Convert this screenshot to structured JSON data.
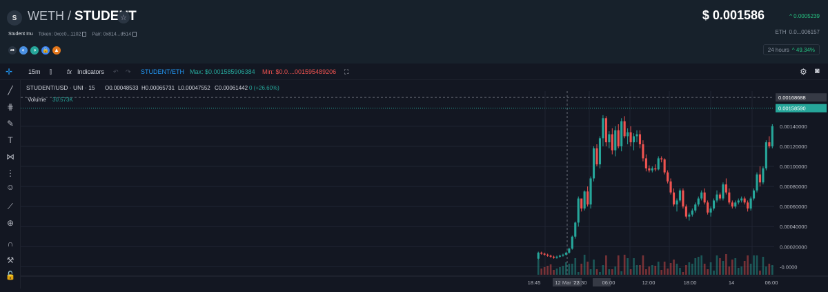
{
  "header": {
    "logo_letter": "S",
    "base": "WETH",
    "slash": " / ",
    "quote": "STUDENT",
    "token_name": "Student Inu",
    "token_label": "Token: 0xcc0...1102",
    "pair_label": "Pair: 0x814...d514",
    "price": "$ 0.001586",
    "price_delta": "^ 0.0005239",
    "eth_label": "ETH",
    "eth_value": "0.0...006157",
    "period": "24 hours",
    "period_change": "^ 49.34%"
  },
  "toolbar": {
    "interval": "15m",
    "indicators": "Indicators",
    "symbol": "STUDENT/ETH",
    "max_label": "Max: $0.001585906384",
    "min_label": "Min: $0.0....001595489206"
  },
  "legend": {
    "title": "STUDENT/USD · UNI · 15",
    "o": "O0.00048533",
    "h": "H0.00065731",
    "l": "L0.00047552",
    "c": "C0.00061442",
    "chg": "0 (+26.60%)",
    "volume_label": "Volume",
    "volume_value": "30.573K"
  },
  "colors": {
    "up": "#26a69a",
    "down": "#ef5350",
    "accent": "#2196f3",
    "bg": "#131722"
  },
  "chart_data": {
    "type": "candlestick",
    "title": "STUDENT/USD · UNI · 15",
    "y_ticks": [
      "0.00140000",
      "0.00120000",
      "0.00100000",
      "0.00080000",
      "0.00060000",
      "0.00040000",
      "0.00020000",
      "-0.0000"
    ],
    "y_tick_values": [
      0.0014,
      0.0012,
      0.001,
      0.0008,
      0.0006,
      0.0004,
      0.0002,
      0
    ],
    "ylim": [
      -8e-05,
      0.00175
    ],
    "price_label": "0.00158590",
    "crosshair_label": "0.00168688",
    "crosshair_value": 0.00168688,
    "x_ticks": [
      "18:45",
      "12 Mar '22",
      "23:30",
      "06:00",
      "12:00",
      "18:00",
      "14",
      "06:00"
    ],
    "candles": [
      [
        8e-05,
        0.00015,
        7e-05,
        0.00014
      ],
      [
        0.00014,
        0.00015,
        0.00012,
        0.00013
      ],
      [
        0.00013,
        0.00014,
        0.00011,
        0.00012
      ],
      [
        0.00012,
        0.00013,
        0.0001,
        0.00011
      ],
      [
        0.00011,
        0.00012,
        9e-05,
        0.0001
      ],
      [
        0.0001,
        0.00011,
        8e-05,
        9e-05
      ],
      [
        9e-05,
        0.00011,
        8e-05,
        0.0001
      ],
      [
        0.0001,
        0.00012,
        9e-05,
        0.00011
      ],
      [
        0.00011,
        0.00013,
        0.0001,
        0.00012
      ],
      [
        0.00012,
        0.00015,
        0.00011,
        0.00014
      ],
      [
        0.00014,
        0.00019,
        0.00013,
        0.00018
      ],
      [
        0.00018,
        0.00031,
        0.00017,
        0.0003
      ],
      [
        0.0003,
        0.00045,
        0.00028,
        0.00044
      ],
      [
        0.00044,
        0.0007,
        0.0004,
        0.00068
      ],
      [
        0.00068,
        0.00062,
        0.00055,
        0.00058
      ],
      [
        0.00058,
        0.00076,
        0.00056,
        0.00075
      ],
      [
        0.00075,
        0.0008,
        0.0006,
        0.00062
      ],
      [
        0.00062,
        0.0009,
        0.00058,
        0.00088
      ],
      [
        0.00088,
        0.0012,
        0.00085,
        0.00118
      ],
      [
        0.00118,
        0.00122,
        0.001,
        0.00102
      ],
      [
        0.00102,
        0.0013,
        0.00098,
        0.00128
      ],
      [
        0.00128,
        0.00151,
        0.0012,
        0.00148
      ],
      [
        0.00148,
        0.0015,
        0.0012,
        0.00124
      ],
      [
        0.00124,
        0.00135,
        0.00118,
        0.00132
      ],
      [
        0.00132,
        0.00138,
        0.00112,
        0.00116
      ],
      [
        0.00116,
        0.0014,
        0.0011,
        0.00136
      ],
      [
        0.00136,
        0.00142,
        0.00118,
        0.0012
      ],
      [
        0.0012,
        0.00148,
        0.00115,
        0.00145
      ],
      [
        0.00145,
        0.0015,
        0.00128,
        0.0013
      ],
      [
        0.0013,
        0.00138,
        0.00122,
        0.00134
      ],
      [
        0.00134,
        0.0014,
        0.0012,
        0.00124
      ],
      [
        0.00124,
        0.00133,
        0.00116,
        0.0013
      ],
      [
        0.0013,
        0.00136,
        0.00124,
        0.00132
      ],
      [
        0.00132,
        0.00136,
        0.00118,
        0.00122
      ],
      [
        0.00122,
        0.00126,
        0.00105,
        0.00108
      ],
      [
        0.00108,
        0.00112,
        0.00095,
        0.00098
      ],
      [
        0.00098,
        0.00101,
        0.00094,
        0.00096
      ],
      [
        0.00096,
        0.001,
        0.00094,
        0.00098
      ],
      [
        0.00098,
        0.00102,
        0.00095,
        0.00097
      ],
      [
        0.00097,
        0.0011,
        0.00096,
        0.00108
      ],
      [
        0.00108,
        0.0011,
        0.00104,
        0.00107
      ],
      [
        0.00107,
        0.00108,
        0.00092,
        0.00094
      ],
      [
        0.00094,
        0.00096,
        0.00083,
        0.00085
      ],
      [
        0.00085,
        0.00088,
        0.00072,
        0.00074
      ],
      [
        0.00074,
        0.00078,
        0.0006,
        0.00062
      ],
      [
        0.00062,
        0.00068,
        0.00055,
        0.00066
      ],
      [
        0.00066,
        0.00078,
        0.00064,
        0.00076
      ],
      [
        0.00076,
        0.00078,
        0.00058,
        0.0006
      ],
      [
        0.0006,
        0.00062,
        0.00048,
        0.0005
      ],
      [
        0.0005,
        0.00054,
        0.00046,
        0.00052
      ],
      [
        0.00052,
        0.00058,
        0.0005,
        0.00056
      ],
      [
        0.00056,
        0.00064,
        0.00054,
        0.00062
      ],
      [
        0.00062,
        0.0007,
        0.0006,
        0.00068
      ],
      [
        0.00068,
        0.00076,
        0.00066,
        0.00074
      ],
      [
        0.00074,
        0.00078,
        0.00062,
        0.00064
      ],
      [
        0.00064,
        0.00066,
        0.00052,
        0.00054
      ],
      [
        0.00054,
        0.0006,
        0.0005,
        0.00058
      ],
      [
        0.00058,
        0.00068,
        0.00056,
        0.00066
      ],
      [
        0.00066,
        0.00076,
        0.00064,
        0.00072
      ],
      [
        0.00072,
        0.00074,
        0.00066,
        0.00068
      ],
      [
        0.00068,
        0.00084,
        0.00066,
        0.00082
      ],
      [
        0.00082,
        0.00088,
        0.00072,
        0.00074
      ],
      [
        0.00074,
        0.00078,
        0.00062,
        0.00064
      ],
      [
        0.00064,
        0.00066,
        0.00058,
        0.0006
      ],
      [
        0.0006,
        0.00066,
        0.00058,
        0.00064
      ],
      [
        0.00064,
        0.00068,
        0.00062,
        0.00066
      ],
      [
        0.00066,
        0.0007,
        0.00064,
        0.00068
      ],
      [
        0.00068,
        0.0007,
        0.00062,
        0.00064
      ],
      [
        0.00064,
        0.00066,
        0.00055,
        0.00058
      ],
      [
        0.00058,
        0.0007,
        0.00056,
        0.00068
      ],
      [
        0.00068,
        0.00078,
        0.00066,
        0.00076
      ],
      [
        0.00076,
        0.00094,
        0.00074,
        0.00092
      ],
      [
        0.00092,
        0.001,
        0.0008,
        0.00084
      ],
      [
        0.00084,
        0.001,
        0.00082,
        0.00098
      ],
      [
        0.00098,
        0.00126,
        0.00096,
        0.00124
      ],
      [
        0.00124,
        0.0013,
        0.00118,
        0.0012
      ],
      [
        0.0012,
        0.00142,
        0.00118,
        0.0014
      ],
      [
        0.0014,
        0.0016,
        0.00138,
        0.00158
      ]
    ]
  }
}
